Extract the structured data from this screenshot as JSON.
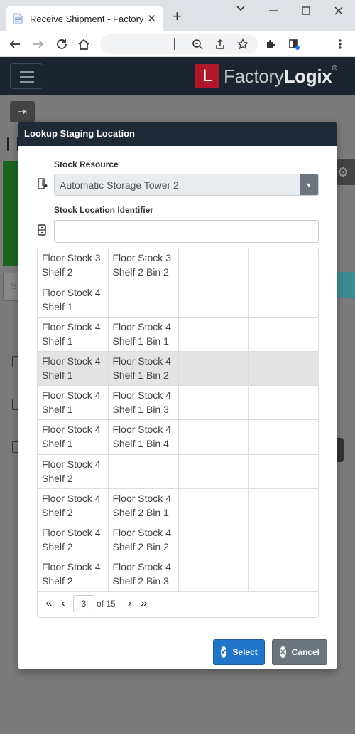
{
  "browser": {
    "tab_title": "Receive Shipment - FactoryLo",
    "tab_close": "✕",
    "new_tab": "+",
    "minimize": "⌄",
    "window_min": "—",
    "window_max": "☐",
    "window_close": "✕"
  },
  "app": {
    "brand_letter": "L",
    "brand_name_light": "Factory",
    "brand_name_bold": "Logix",
    "brand_reg": "®",
    "collapse_icon": "⇥",
    "gear_icon": "⚙",
    "bg_input_letter": "S"
  },
  "modal": {
    "title": "Lookup Staging Location",
    "stock_resource_label": "Stock Resource",
    "stock_resource_value": "Automatic Storage Tower 2",
    "stock_location_label": "Stock Location Identifier",
    "stock_location_value": "",
    "rows": [
      {
        "col1": "Floor Stock 3 Shelf 2",
        "col2": "Floor Stock 3 Shelf 2 Bin 2",
        "col3": "",
        "col4": ""
      },
      {
        "col1": "Floor Stock 4 Shelf 1",
        "col2": "",
        "col3": "",
        "col4": ""
      },
      {
        "col1": "Floor Stock 4 Shelf 1",
        "col2": "Floor Stock 4 Shelf 1 Bin 1",
        "col3": "",
        "col4": ""
      },
      {
        "col1": "Floor Stock 4 Shelf 1",
        "col2": "Floor Stock 4 Shelf 1 Bin 2",
        "col3": "",
        "col4": ""
      },
      {
        "col1": "Floor Stock 4 Shelf 1",
        "col2": "Floor Stock 4 Shelf 1 Bin 3",
        "col3": "",
        "col4": ""
      },
      {
        "col1": "Floor Stock 4 Shelf 1",
        "col2": "Floor Stock 4 Shelf 1 Bin 4",
        "col3": "",
        "col4": ""
      },
      {
        "col1": "Floor Stock 4 Shelf 2",
        "col2": "",
        "col3": "",
        "col4": ""
      },
      {
        "col1": "Floor Stock 4 Shelf 2",
        "col2": "Floor Stock 4 Shelf 2 Bin 1",
        "col3": "",
        "col4": ""
      },
      {
        "col1": "Floor Stock 4 Shelf 2",
        "col2": "Floor Stock 4 Shelf 2 Bin 2",
        "col3": "",
        "col4": ""
      },
      {
        "col1": "Floor Stock 4 Shelf 2",
        "col2": "Floor Stock 4 Shelf 2 Bin 3",
        "col3": "",
        "col4": ""
      }
    ],
    "selected_row": 3,
    "pager": {
      "first": "«",
      "prev": "‹",
      "current_page": "3",
      "of_label": "of 15",
      "next": "›",
      "last": "»"
    },
    "select_button": "Select",
    "cancel_button": "Cancel"
  },
  "colors": {
    "header": "#1e2a38",
    "select_button": "#2175c8",
    "cancel_button": "#6c757d",
    "brand_red": "#b0182a"
  }
}
